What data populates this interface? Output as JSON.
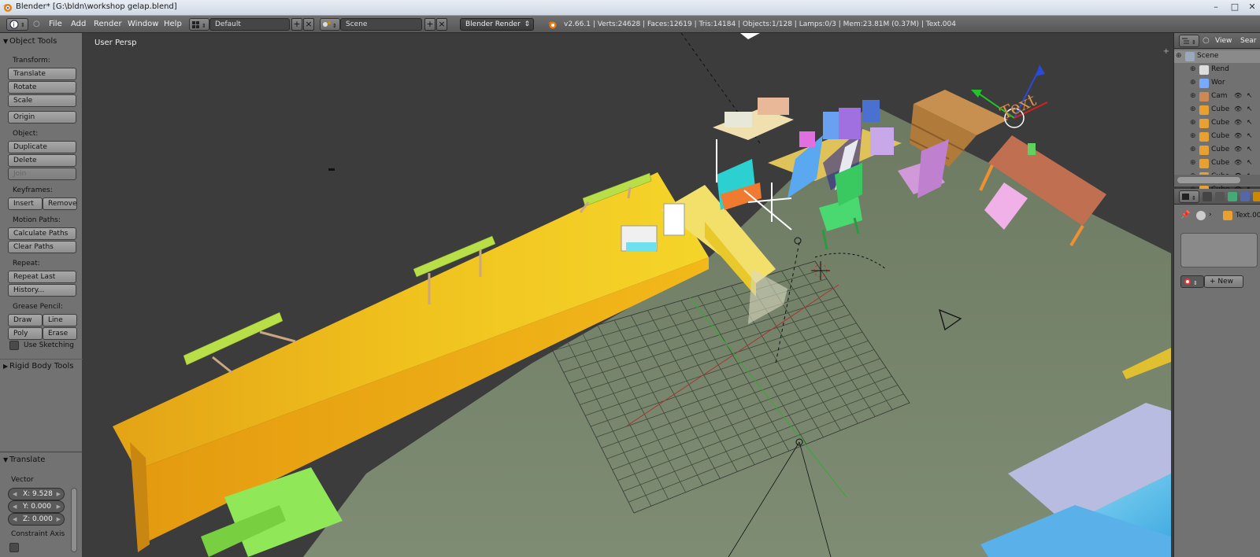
{
  "window": {
    "title": "Blender* [G:\\bldn\\workshop gelap.blend]",
    "controls": [
      "–",
      "□",
      "✕"
    ]
  },
  "menu": [
    "File",
    "Add",
    "Render",
    "Window",
    "Help"
  ],
  "header": {
    "screen_layout": "Default",
    "scene": "Scene",
    "render_engine": "Blender Render",
    "stats": "v2.66.1 | Verts:24628 | Faces:12619 | Tris:14184 | Objects:1/128 | Lamps:0/3 | Mem:23.81M (0.37M) | Text.004"
  },
  "toolshelf": {
    "panel_title": "Object Tools",
    "transform_label": "Transform:",
    "translate": "Translate",
    "rotate": "Rotate",
    "scale": "Scale",
    "origin": "Origin",
    "object_label": "Object:",
    "duplicate": "Duplicate Objects",
    "delete": "Delete",
    "join": "Join",
    "keyframes_label": "Keyframes:",
    "insert": "Insert",
    "remove": "Remove",
    "motion_label": "Motion Paths:",
    "calc_paths": "Calculate Paths",
    "clear_paths": "Clear Paths",
    "repeat_label": "Repeat:",
    "repeat_last": "Repeat Last",
    "history": "History...",
    "grease_label": "Grease Pencil:",
    "draw": "Draw",
    "line": "Line",
    "poly": "Poly",
    "erase": "Erase",
    "use_sketching": "Use Sketching",
    "rigid_body": "Rigid Body Tools"
  },
  "operator": {
    "title": "Translate",
    "vector_label": "Vector",
    "x": "X: 9.528",
    "y": "Y: 0.000",
    "z": "Z: 0.000",
    "constraint": "Constraint Axis"
  },
  "viewport": {
    "view_label": "User Persp",
    "text_object": "Text"
  },
  "outliner": {
    "view_menu": "View",
    "search_menu": "Sear",
    "rows": [
      {
        "label": "Scene"
      },
      {
        "label": "Rend"
      },
      {
        "label": "Wor"
      },
      {
        "label": "Cam"
      },
      {
        "label": "Cube"
      },
      {
        "label": "Cube"
      },
      {
        "label": "Cube"
      },
      {
        "label": "Cube"
      },
      {
        "label": "Cube"
      },
      {
        "label": "Cube"
      },
      {
        "label": "Cube"
      }
    ]
  },
  "properties": {
    "object_name": "Text.00",
    "new_button": "New"
  },
  "colors": {
    "viewport_bg_top": "#3a3a3a",
    "floor": "#7d8a70",
    "table_yellow": "#e8c21a",
    "shelf_green": "#b8de48"
  }
}
